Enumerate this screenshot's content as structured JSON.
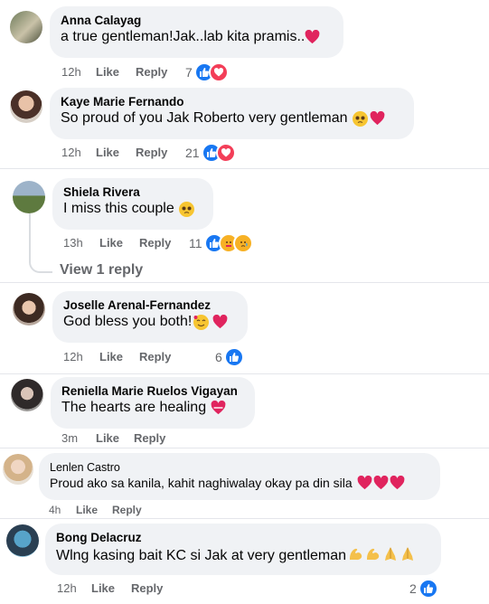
{
  "comments": [
    {
      "author": "Anna Calayag",
      "text": "a true gentleman!Jak..lab kita pramis..",
      "time": "12h",
      "like": "Like",
      "reply": "Reply",
      "count": "7",
      "emojis": [
        "heart"
      ]
    },
    {
      "author": "Kaye Marie Fernando",
      "text": "So proud of you Jak Roberto very gentleman",
      "time": "12h",
      "like": "Like",
      "reply": "Reply",
      "count": "21",
      "emojis": [
        "pleading-face",
        "heart"
      ]
    },
    {
      "author": "Shiela Rivera",
      "text": "I miss this couple",
      "time": "13h",
      "like": "Like",
      "reply": "Reply",
      "count": "11",
      "emojis": [
        "pleading-face"
      ]
    },
    {
      "author": "Joselle Arenal-Fernandez",
      "text": "God bless you both!",
      "time": "12h",
      "like": "Like",
      "reply": "Reply",
      "count": "6",
      "emojis": [
        "smiling-hearts-face",
        "heart"
      ]
    },
    {
      "author": "Reniella Marie Ruelos Vigayan",
      "text": "The hearts are healing",
      "time": "3m",
      "like": "Like",
      "reply": "Reply",
      "count": "",
      "emojis": [
        "heart"
      ]
    },
    {
      "author": "Lenlen Castro",
      "text": "Proud ako sa kanila, kahit naghiwalay okay pa din sila",
      "time": "4h",
      "like": "Like",
      "reply": "Reply",
      "count": "",
      "emojis": [
        "heart",
        "heart",
        "heart"
      ]
    },
    {
      "author": "Bong Delacruz",
      "text": "Wlng kasing bait KC si Jak at very gentleman",
      "time": "12h",
      "like": "Like",
      "reply": "Reply",
      "count": "2",
      "emojis": [
        "flexed-biceps",
        "flexed-biceps",
        "folded-hands",
        "folded-hands"
      ]
    }
  ],
  "view_replies": "View 1 reply",
  "colors": {
    "like": "#1877f2",
    "love": "#f33e58",
    "bubble": "#f0f2f5",
    "meta": "#65676b"
  }
}
